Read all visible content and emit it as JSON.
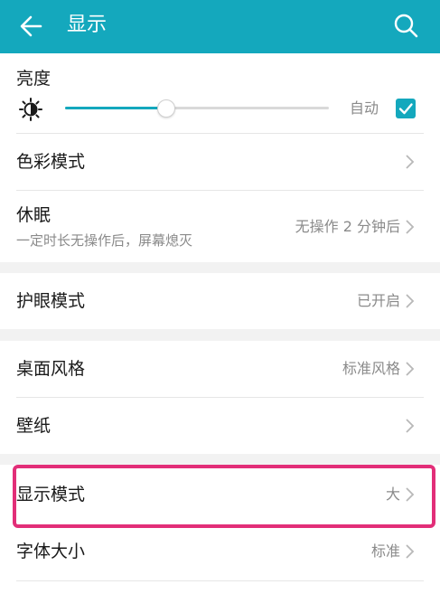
{
  "app_bar": {
    "title": "显示",
    "background": "#14a8bd",
    "back_icon": "arrow-left-icon",
    "search_icon": "search-icon"
  },
  "brightness": {
    "label": "亮度",
    "icon": "sun-icon",
    "level": 0.38,
    "auto_label": "自动",
    "auto_checked": true
  },
  "rows": {
    "color_mode": {
      "title": "色彩模式"
    },
    "sleep": {
      "title": "休眠",
      "subtitle": "一定时长无操作后，屏幕熄灭",
      "value": "无操作 2 分钟后"
    },
    "eye_comfort": {
      "title": "护眼模式",
      "value": "已开启"
    },
    "home_style": {
      "title": "桌面风格",
      "value": "标准风格"
    },
    "wallpaper": {
      "title": "壁纸"
    },
    "display_mode": {
      "title": "显示模式",
      "value": "大"
    },
    "font_size": {
      "title": "字体大小",
      "value": "标准"
    }
  },
  "colors": {
    "accent": "#14a8bd",
    "highlight_border": "#e22e78"
  }
}
